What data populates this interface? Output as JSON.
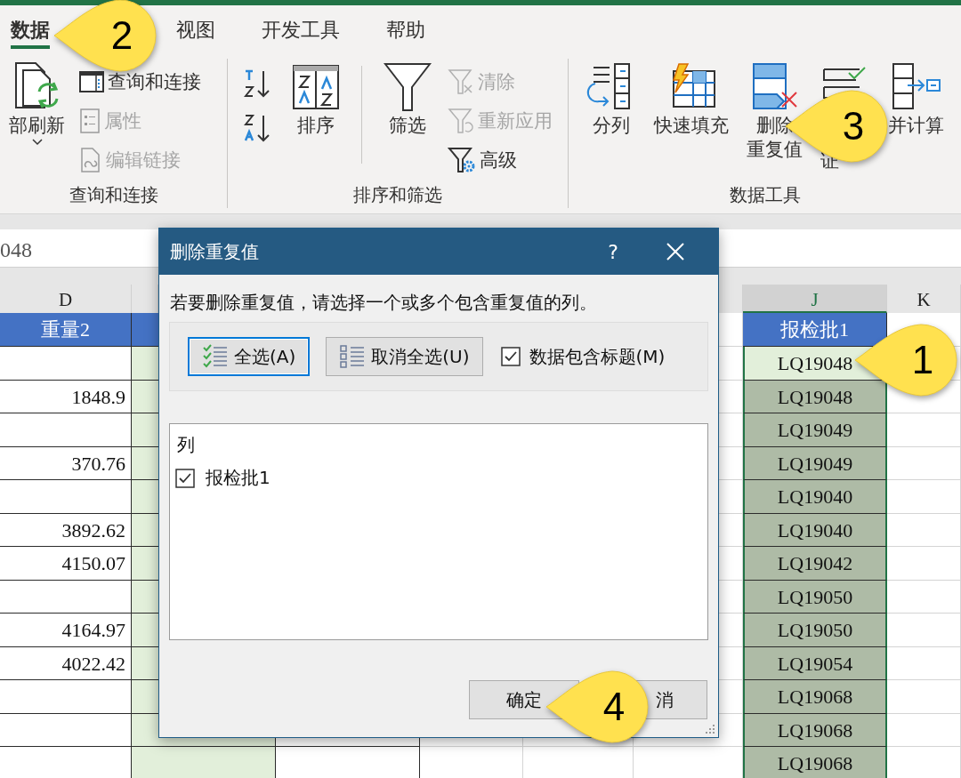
{
  "ribbon": {
    "tabs": [
      {
        "label": "数据",
        "selected": true
      },
      {
        "label": "视图",
        "selected": false
      },
      {
        "label": "开发工具",
        "selected": false
      },
      {
        "label": "帮助",
        "selected": false
      }
    ],
    "groups": [
      {
        "label": "查询和连接",
        "items": [
          {
            "kind": "large",
            "label": [
              "部刷新"
            ],
            "dropdown": true
          },
          {
            "kind": "stack",
            "buttons": [
              {
                "label": "查询和连接",
                "disabled": false
              },
              {
                "label": "属性",
                "disabled": true
              },
              {
                "label": "编辑链接",
                "disabled": true
              }
            ]
          }
        ]
      },
      {
        "label": "排序和筛选",
        "items": [
          {
            "kind": "icons"
          },
          {
            "kind": "large",
            "label": [
              "排序"
            ],
            "divider_after": true
          },
          {
            "kind": "large",
            "label": [
              "筛选"
            ]
          },
          {
            "kind": "stack",
            "buttons": [
              {
                "label": "清除",
                "disabled": true
              },
              {
                "label": "重新应用",
                "disabled": true
              },
              {
                "label": "高级",
                "disabled": false
              }
            ]
          }
        ]
      },
      {
        "label": "数据工具",
        "items": [
          {
            "kind": "large",
            "label": [
              "分列"
            ]
          },
          {
            "kind": "large",
            "label": [
              "快速填充"
            ]
          },
          {
            "kind": "large",
            "label": [
              "删除",
              "重复值"
            ]
          },
          {
            "kind": "large",
            "label": [
              "证"
            ]
          },
          {
            "kind": "large",
            "label": [
              "并计算"
            ]
          }
        ]
      }
    ]
  },
  "formula_bar": {
    "value": "048"
  },
  "sheet": {
    "columns": [
      {
        "letter": "D",
        "heading": "重量2",
        "selected": false
      },
      {
        "letter": "J",
        "heading": "报检批1",
        "selected": true
      },
      {
        "letter": "K",
        "selected": false
      }
    ],
    "rows": [
      {
        "batch": "LQ19048",
        "active": true
      },
      {
        "weight": "1848.9",
        "batch": "LQ19048",
        "active": false
      },
      {
        "batch": "LQ19049",
        "active": false
      },
      {
        "weight": "370.76",
        "batch": "LQ19049",
        "active": false
      },
      {
        "batch": "LQ19040",
        "active": false
      },
      {
        "weight": "3892.62",
        "batch": "LQ19040",
        "active": false
      },
      {
        "weight": "4150.07",
        "batch": "LQ19042",
        "active": false
      },
      {
        "batch": "LQ19050",
        "active": false
      },
      {
        "weight": "4164.97",
        "batch": "LQ19050",
        "active": false
      },
      {
        "weight": "4022.42",
        "batch": "LQ19054",
        "active": false
      },
      {
        "batch": "LQ19068",
        "active": false
      },
      {
        "batch": "LQ19068",
        "active": false
      },
      {
        "batch": "LQ19068",
        "active": false
      }
    ]
  },
  "dialog": {
    "title": "删除重复值",
    "help": "?",
    "instruction": "若要删除重复值，请选择一个或多个包含重复值的列。",
    "select_buttons": [
      {
        "kind": "select-all",
        "label": "全选(A)",
        "focused": true
      },
      {
        "kind": "unselect-all",
        "label": "取消全选(U)",
        "focused": false
      }
    ],
    "has_headers": {
      "label": "数据包含标题(M)",
      "checked": true
    },
    "list": {
      "header": "列",
      "items": [
        {
          "label": "报检批1",
          "checked": true
        }
      ]
    },
    "buttons": [
      {
        "label": "确定"
      },
      {
        "label": "消"
      }
    ]
  },
  "callouts": [
    {
      "number": "1"
    },
    {
      "number": "2"
    },
    {
      "number": "3"
    },
    {
      "number": "4"
    }
  ]
}
